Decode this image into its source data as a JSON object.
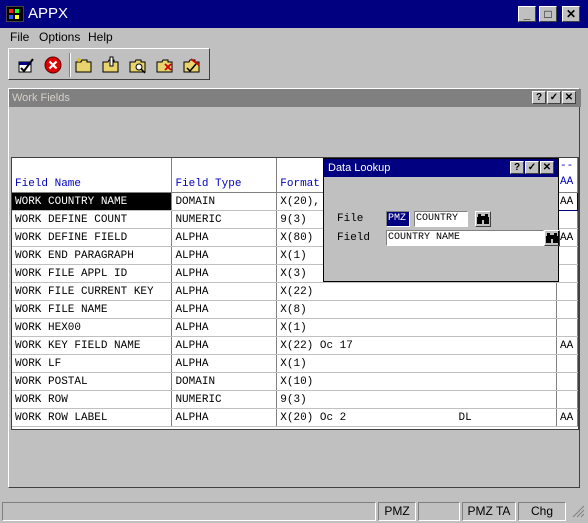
{
  "window": {
    "title": "APPX"
  },
  "menu": [
    "File",
    "Options",
    "Help"
  ],
  "toolbar": {
    "icons": [
      "accept-icon",
      "cancel-icon",
      "new-folder-icon",
      "edit-folder-icon",
      "search-folder-icon",
      "delete-folder-icon",
      "mark-folder-icon"
    ]
  },
  "work_fields": {
    "title": "Work Fields",
    "columns": [
      "Field Name",
      "Field Type",
      "Format",
      "--\nAA"
    ],
    "rows": [
      {
        "name": "WORK COUNTRY NAME",
        "type": "DOMAIN",
        "format": "X(20),",
        "flag": "AA",
        "selected": true
      },
      {
        "name": "WORK DEFINE COUNT",
        "type": "NUMERIC",
        "format": "9(3)",
        "flag": ""
      },
      {
        "name": "WORK DEFINE FIELD",
        "type": "ALPHA",
        "format": "X(80)",
        "flag": "AA"
      },
      {
        "name": "WORK END PARAGRAPH",
        "type": "ALPHA",
        "format": "X(1)",
        "flag": ""
      },
      {
        "name": "WORK FILE APPL ID",
        "type": "ALPHA",
        "format": "X(3)",
        "flag": ""
      },
      {
        "name": "WORK FILE CURRENT KEY",
        "type": "ALPHA",
        "format": "X(22)",
        "flag": ""
      },
      {
        "name": "WORK FILE NAME",
        "type": "ALPHA",
        "format": "X(8)",
        "flag": ""
      },
      {
        "name": "WORK HEX00",
        "type": "ALPHA",
        "format": "X(1)",
        "flag": ""
      },
      {
        "name": "WORK KEY FIELD NAME",
        "type": "ALPHA",
        "format": "X(22) Oc 17",
        "flag": "AA"
      },
      {
        "name": "WORK LF",
        "type": "ALPHA",
        "format": "X(1)",
        "flag": ""
      },
      {
        "name": "WORK POSTAL",
        "type": "DOMAIN",
        "format": "X(10)",
        "flag": ""
      },
      {
        "name": "WORK ROW",
        "type": "NUMERIC",
        "format": "9(3)",
        "flag": ""
      },
      {
        "name": "WORK ROW LABEL",
        "type": "ALPHA",
        "format": "X(20) Oc 2                 DL",
        "flag": "AA"
      }
    ]
  },
  "lookup": {
    "title": "Data Lookup",
    "file_label": "File",
    "file_app": "PMZ",
    "file_name": "COUNTRY",
    "field_label": "Field",
    "field_value": "COUNTRY NAME"
  },
  "status": [
    "PMZ",
    "PMZ TA",
    "Chg"
  ],
  "colors": {
    "titlebar": "#000080",
    "header_text": "#0000c0",
    "face": "#c0c0c0"
  }
}
